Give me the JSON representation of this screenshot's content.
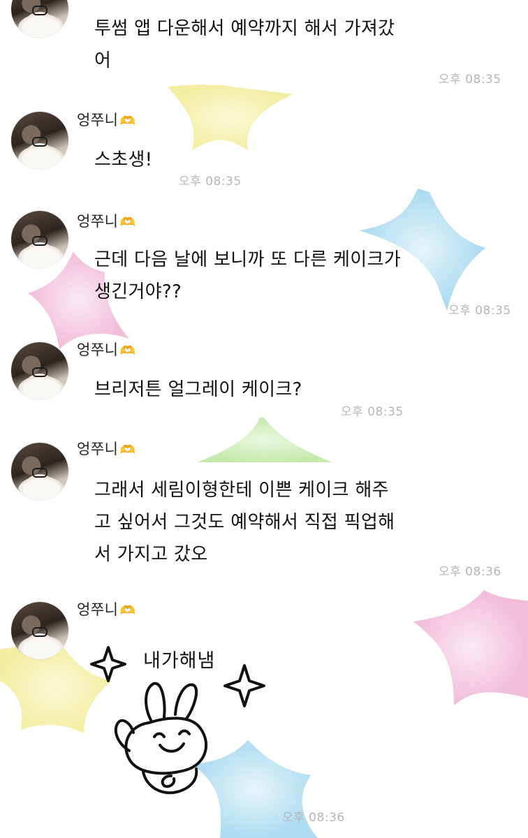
{
  "messages": [
    {
      "lines": [
        "투썸 앱 다운해서 예약까지 해서 가져갔",
        "어"
      ],
      "time": "오후 08:35"
    },
    {
      "sender": "엉쭈니",
      "lines": [
        "스초생!"
      ],
      "time": "오후 08:35"
    },
    {
      "sender": "엉쭈니",
      "lines": [
        "근데 다음 날에 보니까 또 다른 케이크가",
        "생긴거야??"
      ],
      "time": "오후 08:35"
    },
    {
      "sender": "엉쭈니",
      "lines": [
        "브리저튼 얼그레이 케이크?"
      ],
      "time": "오후 08:35"
    },
    {
      "sender": "엉쭈니",
      "lines": [
        "그래서 세림이형한테 이쁜 케이크 해주",
        "고 싶어서 그것도 예약해서 직접 픽업해",
        "서 가지고 갔오"
      ],
      "time": "오후 08:36"
    },
    {
      "sender": "엉쭈니",
      "emoticon_text": "내가해냄",
      "time": "오후 08:36"
    }
  ],
  "sender_heart": "🫶",
  "colors": {
    "star_yellow": "#f7f3a6",
    "star_blue": "#a9dcf0",
    "star_pink": "#f3b9d8",
    "star_green": "#c6ecb0",
    "time_gray": "#b6b6b6"
  }
}
